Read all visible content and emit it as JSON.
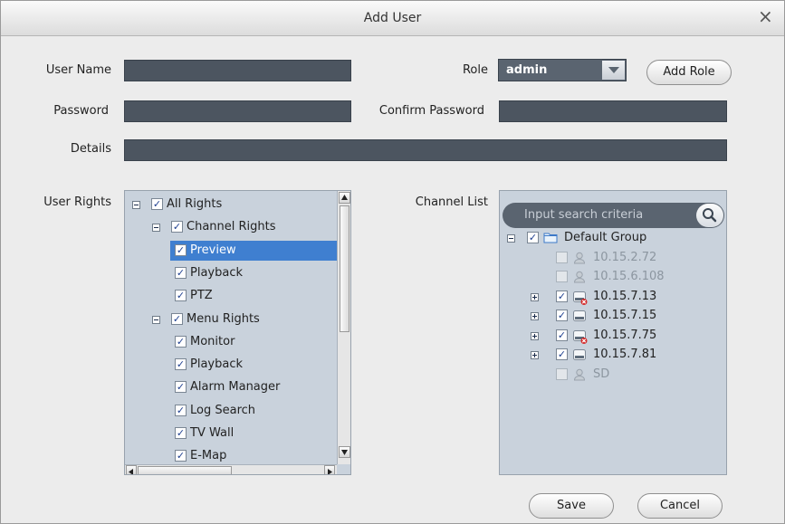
{
  "window": {
    "title": "Add User",
    "close_glyph": "×"
  },
  "form": {
    "user_name_label": "User Name",
    "user_name_value": "",
    "password_label": "Password",
    "password_value": "",
    "details_label": "Details",
    "details_value": "",
    "role_label": "Role",
    "role_value": "admin",
    "confirm_password_label": "Confirm Password",
    "confirm_password_value": "",
    "add_role_label": "Add Role"
  },
  "user_rights": {
    "label": "User Rights",
    "nodes": [
      {
        "label": "All Rights",
        "checked": true,
        "toggle": "minus"
      },
      {
        "label": "Channel Rights",
        "checked": true,
        "toggle": "minus"
      },
      {
        "label": "Preview",
        "checked": true,
        "selected": true
      },
      {
        "label": "Playback",
        "checked": true
      },
      {
        "label": "PTZ",
        "checked": true
      },
      {
        "label": "Menu Rights",
        "checked": true,
        "toggle": "minus"
      },
      {
        "label": "Monitor",
        "checked": true
      },
      {
        "label": "Playback",
        "checked": true
      },
      {
        "label": "Alarm Manager",
        "checked": true
      },
      {
        "label": "Log Search",
        "checked": true
      },
      {
        "label": "TV Wall",
        "checked": true
      },
      {
        "label": "E-Map",
        "checked": true
      }
    ]
  },
  "channel_list": {
    "label": "Channel List",
    "search_placeholder": "Input search criteria",
    "nodes": [
      {
        "label": "Default Group",
        "checked": true,
        "toggle": "minus",
        "icon": "folder-icon"
      },
      {
        "label": "10.15.2.72",
        "checked": false,
        "icon": "camera-user-icon",
        "disabled": true
      },
      {
        "label": "10.15.6.108",
        "checked": false,
        "icon": "camera-user-icon",
        "disabled": true
      },
      {
        "label": "10.15.7.13",
        "checked": true,
        "toggle": "plus",
        "icon": "device-offline-icon"
      },
      {
        "label": "10.15.7.15",
        "checked": true,
        "toggle": "plus",
        "icon": "device-icon"
      },
      {
        "label": "10.15.7.75",
        "checked": true,
        "toggle": "plus",
        "icon": "device-offline-icon"
      },
      {
        "label": "10.15.7.81",
        "checked": true,
        "toggle": "plus",
        "icon": "device-icon"
      },
      {
        "label": "SD",
        "checked": false,
        "icon": "camera-user-icon",
        "disabled": true
      }
    ]
  },
  "buttons": {
    "save_label": "Save",
    "cancel_label": "Cancel"
  },
  "colors": {
    "field_bg": "#4c5560",
    "panel_bg": "#c9d2dc",
    "selection": "#3f7fd0",
    "offline_badge": "#d42a2a"
  }
}
